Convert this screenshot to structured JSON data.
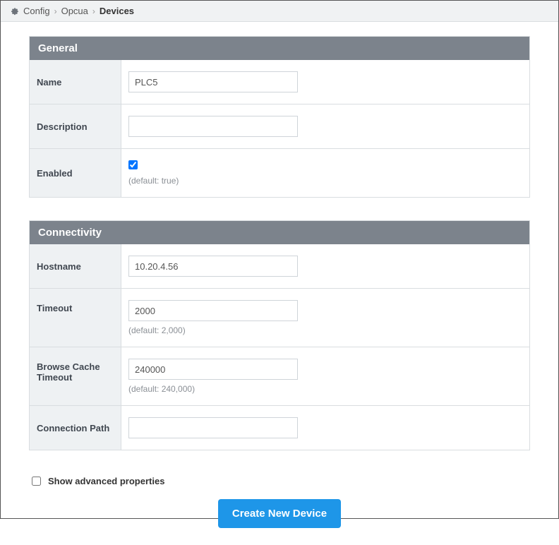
{
  "breadcrumb": {
    "items": [
      "Config",
      "Opcua",
      "Devices"
    ]
  },
  "sections": {
    "general": {
      "title": "General",
      "fields": {
        "name": {
          "label": "Name",
          "value": "PLC5"
        },
        "description": {
          "label": "Description",
          "value": ""
        },
        "enabled": {
          "label": "Enabled",
          "checked": true,
          "hint": "(default: true)"
        }
      }
    },
    "connectivity": {
      "title": "Connectivity",
      "fields": {
        "hostname": {
          "label": "Hostname",
          "value": "10.20.4.56"
        },
        "timeout": {
          "label": "Timeout",
          "value": "2000",
          "hint": "(default: 2,000)"
        },
        "browse_cache_timeout": {
          "label": "Browse Cache Timeout",
          "value": "240000",
          "hint": "(default: 240,000)"
        },
        "connection_path": {
          "label": "Connection Path",
          "value": ""
        }
      }
    }
  },
  "advanced": {
    "label": "Show advanced properties",
    "checked": false
  },
  "actions": {
    "create": "Create New Device"
  }
}
